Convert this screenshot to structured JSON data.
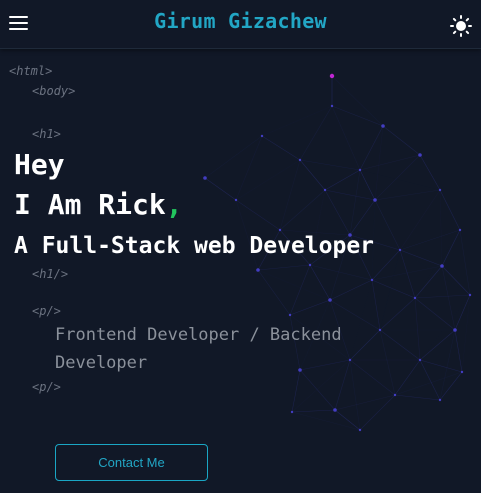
{
  "header": {
    "menu_icon": "hamburger-menu-icon",
    "brand": "Girum Gizachew",
    "theme_icon": "sun-icon"
  },
  "code_tags": {
    "html_open": "<html>",
    "body_open": "<body>",
    "h1_open": "<h1>",
    "h1_close": "<h1/>",
    "p_open": "<p/>",
    "p_close": "<p/>"
  },
  "hero": {
    "greeting": "Hey",
    "intro": "I Am Rick",
    "intro_punct": ",",
    "role": "A Full-Stack web Developer"
  },
  "description": "Frontend Developer / Backend Developer",
  "cta": {
    "label": "Contact Me"
  },
  "colors": {
    "background": "#111827",
    "accent": "#22a6c5",
    "comma": "#22c55e",
    "network": "#3b3fb0"
  }
}
